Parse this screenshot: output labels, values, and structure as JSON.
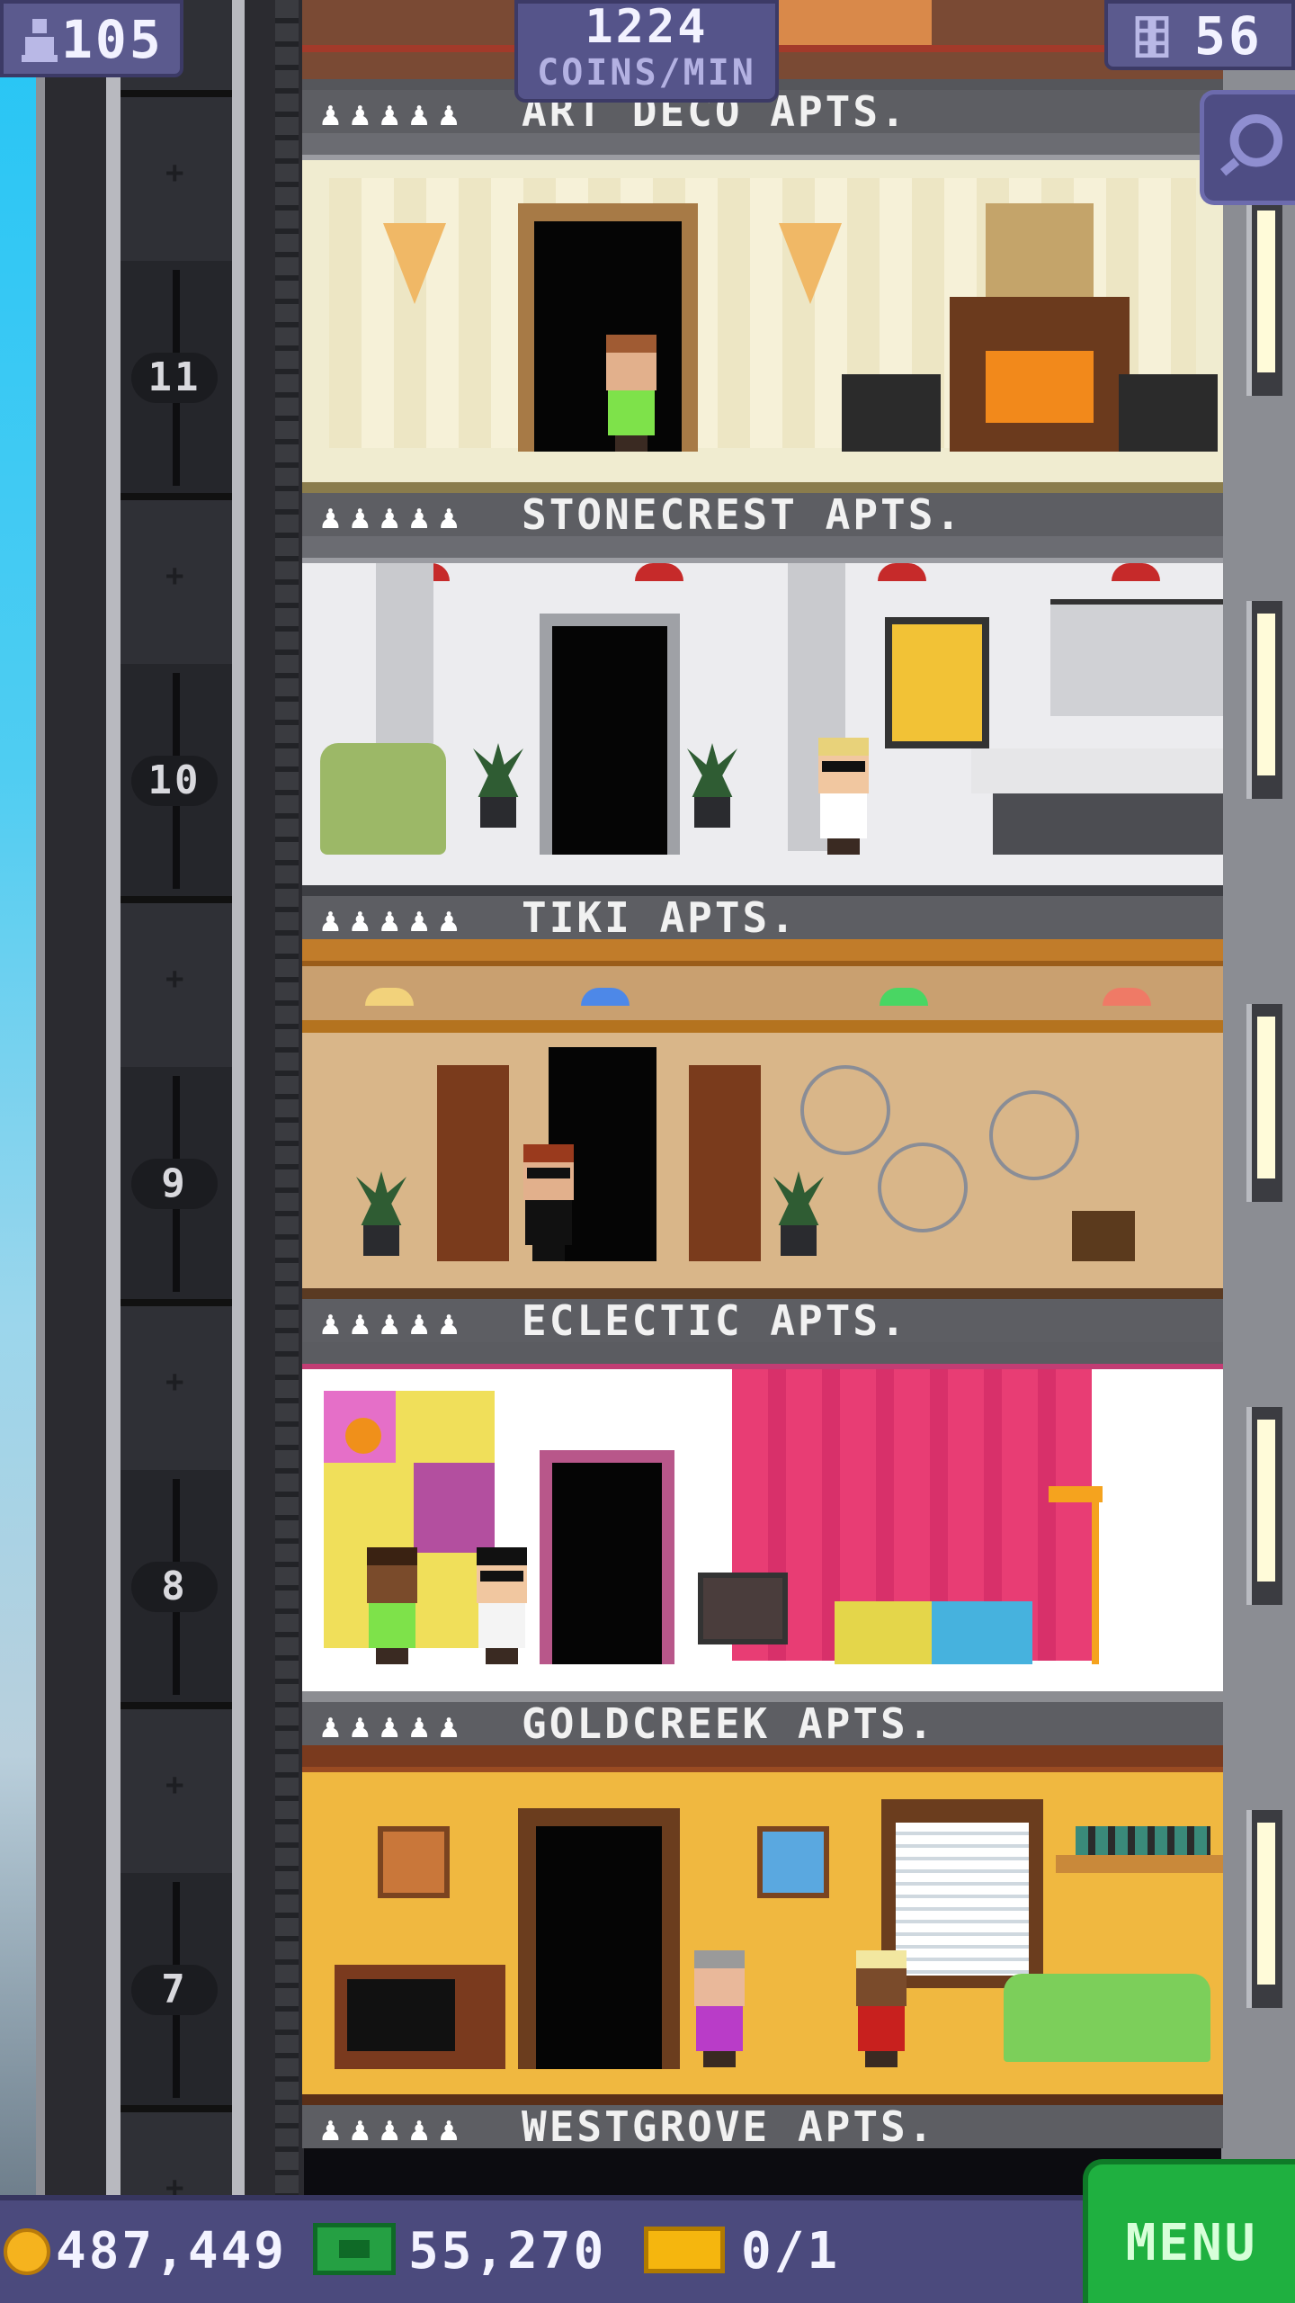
{
  "hud": {
    "population": "105",
    "coins_per_min_value": "1224",
    "coins_per_min_label": "COINS/MIN",
    "floors_count": "56"
  },
  "floors": [
    {
      "name": "ART DECO APTS.",
      "residents": "♟♟♟♟♟"
    },
    {
      "name": "STONECREST APTS.",
      "residents": "♟♟♟♟♟",
      "number": "11"
    },
    {
      "name": "TIKI APTS.",
      "residents": "♟♟♟♟♟",
      "number": "10"
    },
    {
      "name": "ECLECTIC APTS.",
      "residents": "♟♟♟♟♟",
      "number": "9"
    },
    {
      "name": "GOLDCREEK APTS.",
      "residents": "♟♟♟♟♟",
      "number": "8"
    },
    {
      "name": "WESTGROVE APTS.",
      "residents": "♟♟♟♟♟",
      "number": "7"
    }
  ],
  "bottom": {
    "coins": "487,449",
    "bux": "55,270",
    "tickets": "0/1",
    "menu_label": "MENU"
  },
  "colors": {
    "hud_bg": "#5b5a8e",
    "menu_green": "#1fb040",
    "coin_gold": "#f5b31e",
    "bux_green": "#25a043"
  },
  "icons": {
    "population": "person-icon",
    "floors": "building-icon",
    "search": "magnifier-icon",
    "coins": "coin-icon",
    "bux": "tower-bux-icon",
    "tickets": "ticket-icon"
  }
}
